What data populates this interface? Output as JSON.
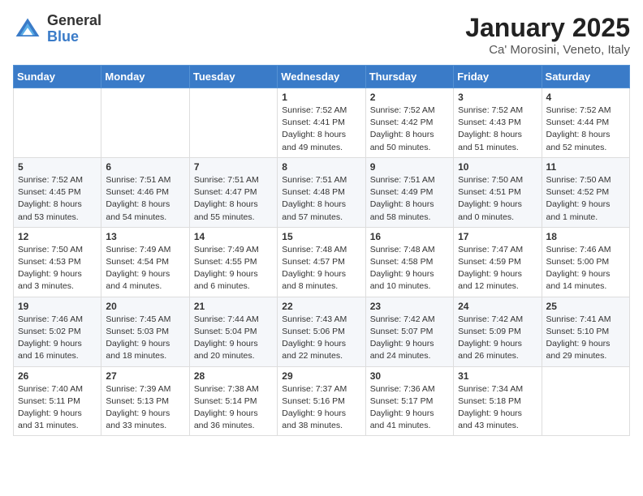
{
  "logo": {
    "general": "General",
    "blue": "Blue"
  },
  "header": {
    "title": "January 2025",
    "subtitle": "Ca' Morosini, Veneto, Italy"
  },
  "days_of_week": [
    "Sunday",
    "Monday",
    "Tuesday",
    "Wednesday",
    "Thursday",
    "Friday",
    "Saturday"
  ],
  "weeks": [
    [
      {
        "day": "",
        "info": ""
      },
      {
        "day": "",
        "info": ""
      },
      {
        "day": "",
        "info": ""
      },
      {
        "day": "1",
        "info": "Sunrise: 7:52 AM\nSunset: 4:41 PM\nDaylight: 8 hours and 49 minutes."
      },
      {
        "day": "2",
        "info": "Sunrise: 7:52 AM\nSunset: 4:42 PM\nDaylight: 8 hours and 50 minutes."
      },
      {
        "day": "3",
        "info": "Sunrise: 7:52 AM\nSunset: 4:43 PM\nDaylight: 8 hours and 51 minutes."
      },
      {
        "day": "4",
        "info": "Sunrise: 7:52 AM\nSunset: 4:44 PM\nDaylight: 8 hours and 52 minutes."
      }
    ],
    [
      {
        "day": "5",
        "info": "Sunrise: 7:52 AM\nSunset: 4:45 PM\nDaylight: 8 hours and 53 minutes."
      },
      {
        "day": "6",
        "info": "Sunrise: 7:51 AM\nSunset: 4:46 PM\nDaylight: 8 hours and 54 minutes."
      },
      {
        "day": "7",
        "info": "Sunrise: 7:51 AM\nSunset: 4:47 PM\nDaylight: 8 hours and 55 minutes."
      },
      {
        "day": "8",
        "info": "Sunrise: 7:51 AM\nSunset: 4:48 PM\nDaylight: 8 hours and 57 minutes."
      },
      {
        "day": "9",
        "info": "Sunrise: 7:51 AM\nSunset: 4:49 PM\nDaylight: 8 hours and 58 minutes."
      },
      {
        "day": "10",
        "info": "Sunrise: 7:50 AM\nSunset: 4:51 PM\nDaylight: 9 hours and 0 minutes."
      },
      {
        "day": "11",
        "info": "Sunrise: 7:50 AM\nSunset: 4:52 PM\nDaylight: 9 hours and 1 minute."
      }
    ],
    [
      {
        "day": "12",
        "info": "Sunrise: 7:50 AM\nSunset: 4:53 PM\nDaylight: 9 hours and 3 minutes."
      },
      {
        "day": "13",
        "info": "Sunrise: 7:49 AM\nSunset: 4:54 PM\nDaylight: 9 hours and 4 minutes."
      },
      {
        "day": "14",
        "info": "Sunrise: 7:49 AM\nSunset: 4:55 PM\nDaylight: 9 hours and 6 minutes."
      },
      {
        "day": "15",
        "info": "Sunrise: 7:48 AM\nSunset: 4:57 PM\nDaylight: 9 hours and 8 minutes."
      },
      {
        "day": "16",
        "info": "Sunrise: 7:48 AM\nSunset: 4:58 PM\nDaylight: 9 hours and 10 minutes."
      },
      {
        "day": "17",
        "info": "Sunrise: 7:47 AM\nSunset: 4:59 PM\nDaylight: 9 hours and 12 minutes."
      },
      {
        "day": "18",
        "info": "Sunrise: 7:46 AM\nSunset: 5:00 PM\nDaylight: 9 hours and 14 minutes."
      }
    ],
    [
      {
        "day": "19",
        "info": "Sunrise: 7:46 AM\nSunset: 5:02 PM\nDaylight: 9 hours and 16 minutes."
      },
      {
        "day": "20",
        "info": "Sunrise: 7:45 AM\nSunset: 5:03 PM\nDaylight: 9 hours and 18 minutes."
      },
      {
        "day": "21",
        "info": "Sunrise: 7:44 AM\nSunset: 5:04 PM\nDaylight: 9 hours and 20 minutes."
      },
      {
        "day": "22",
        "info": "Sunrise: 7:43 AM\nSunset: 5:06 PM\nDaylight: 9 hours and 22 minutes."
      },
      {
        "day": "23",
        "info": "Sunrise: 7:42 AM\nSunset: 5:07 PM\nDaylight: 9 hours and 24 minutes."
      },
      {
        "day": "24",
        "info": "Sunrise: 7:42 AM\nSunset: 5:09 PM\nDaylight: 9 hours and 26 minutes."
      },
      {
        "day": "25",
        "info": "Sunrise: 7:41 AM\nSunset: 5:10 PM\nDaylight: 9 hours and 29 minutes."
      }
    ],
    [
      {
        "day": "26",
        "info": "Sunrise: 7:40 AM\nSunset: 5:11 PM\nDaylight: 9 hours and 31 minutes."
      },
      {
        "day": "27",
        "info": "Sunrise: 7:39 AM\nSunset: 5:13 PM\nDaylight: 9 hours and 33 minutes."
      },
      {
        "day": "28",
        "info": "Sunrise: 7:38 AM\nSunset: 5:14 PM\nDaylight: 9 hours and 36 minutes."
      },
      {
        "day": "29",
        "info": "Sunrise: 7:37 AM\nSunset: 5:16 PM\nDaylight: 9 hours and 38 minutes."
      },
      {
        "day": "30",
        "info": "Sunrise: 7:36 AM\nSunset: 5:17 PM\nDaylight: 9 hours and 41 minutes."
      },
      {
        "day": "31",
        "info": "Sunrise: 7:34 AM\nSunset: 5:18 PM\nDaylight: 9 hours and 43 minutes."
      },
      {
        "day": "",
        "info": ""
      }
    ]
  ]
}
